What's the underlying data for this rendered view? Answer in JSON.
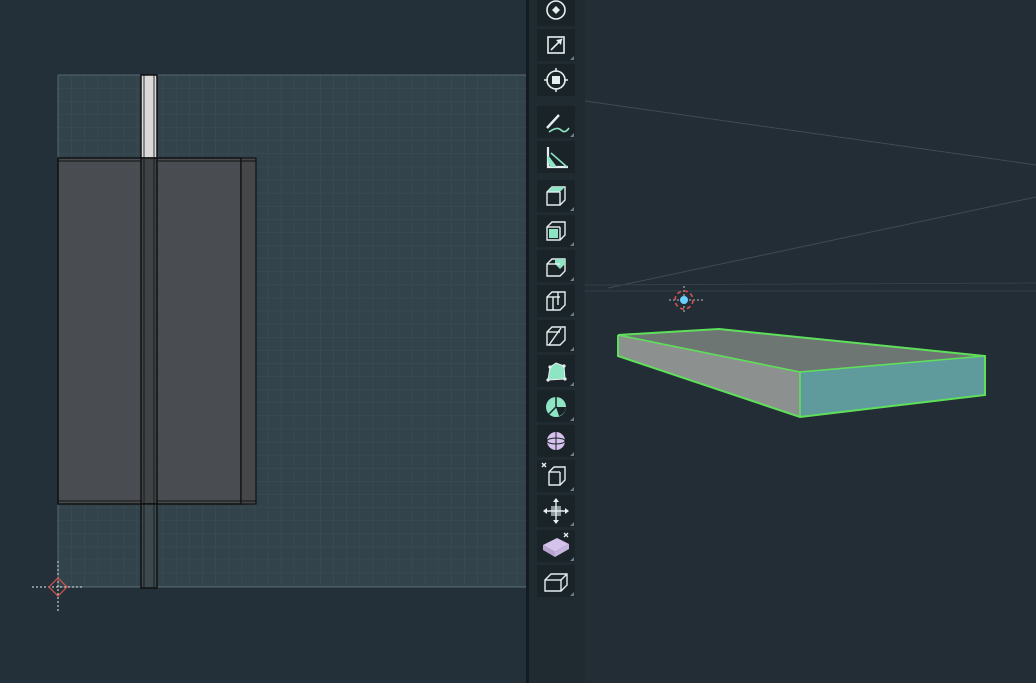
{
  "app": {
    "left_view": "top-view-2d",
    "right_view": "perspective-3d"
  },
  "colors": {
    "background": "#233039",
    "grid_fill": "#33434b",
    "grid_line": "#3f5058",
    "selection_outline": "#5fe05a",
    "toolbar_bg": "#1f2a31",
    "icon_mint": "#8ee5c4",
    "icon_lavender": "#d6c3ec",
    "origin_marker": "#d9534f"
  },
  "toolbar": {
    "tools": [
      {
        "id": "orbit-tool",
        "icon": "orbit-icon"
      },
      {
        "id": "scale-tool",
        "icon": "scale-icon"
      },
      {
        "id": "move-center-tool",
        "icon": "move-center-icon"
      },
      {
        "id": "draw-tool",
        "icon": "pencil-curve-icon"
      },
      {
        "id": "measure-tool",
        "icon": "ruler-angle-icon"
      },
      {
        "id": "extrude-tool",
        "icon": "extrude-box-icon"
      },
      {
        "id": "inset-tool",
        "icon": "inset-box-icon"
      },
      {
        "id": "bevel-tool",
        "icon": "bevel-box-icon"
      },
      {
        "id": "loop-cut-tool",
        "icon": "loop-cut-icon"
      },
      {
        "id": "knife-tool",
        "icon": "knife-box-icon"
      },
      {
        "id": "smooth-tool",
        "icon": "smooth-icon"
      },
      {
        "id": "spin-tool",
        "icon": "spin-icon"
      },
      {
        "id": "shrink-fatten-tool",
        "icon": "sphere-icon"
      },
      {
        "id": "shear-tool",
        "icon": "shear-box-icon"
      },
      {
        "id": "transform-tool",
        "icon": "transform-arrows-icon"
      },
      {
        "id": "rip-tool",
        "icon": "rip-prism-icon"
      },
      {
        "id": "shape-tool",
        "icon": "wire-box-icon"
      }
    ]
  }
}
